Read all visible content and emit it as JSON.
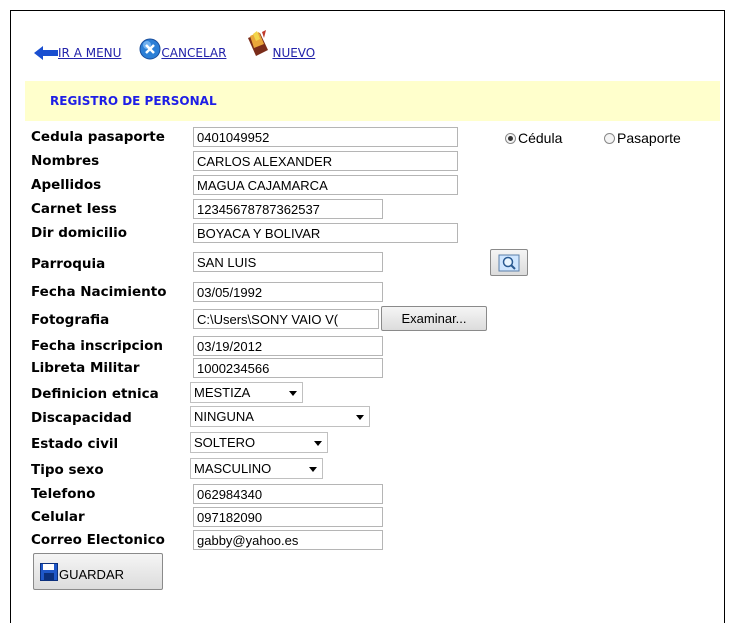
{
  "toolbar": {
    "menu_label": "IR A MENU",
    "cancel_label": "CANCELAR",
    "new_label": "NUEVO"
  },
  "header": {
    "title": "REGISTRO DE PERSONAL"
  },
  "form": {
    "cedula_label": "Cedula pasaporte",
    "cedula_value": "0401049952",
    "doc_type_options": [
      "Cédula",
      "Pasaporte"
    ],
    "doc_type_selected": "Cédula",
    "nombres_label": "Nombres",
    "nombres_value": "CARLOS ALEXANDER",
    "apellidos_label": "Apellidos",
    "apellidos_value": "MAGUA CAJAMARCA",
    "carnet_label": "Carnet Iess",
    "carnet_value": "12345678787362537",
    "dir_label": "Dir domicilio",
    "dir_value": "BOYACA Y BOLIVAR",
    "parroquia_label": "Parroquia",
    "parroquia_value": "SAN LUIS",
    "fecha_nac_label": "Fecha Nacimiento",
    "fecha_nac_value": "03/05/1992",
    "foto_label": "Fotografia",
    "foto_value": "C:\\Users\\SONY VAIO V(",
    "browse_label": "Examinar...",
    "fecha_ins_label": "Fecha inscripcion",
    "fecha_ins_value": "03/19/2012",
    "libreta_label": "Libreta Militar",
    "libreta_value": "1000234566",
    "etnica_label": "Definicion etnica",
    "etnica_value": "MESTIZA",
    "discap_label": "Discapacidad",
    "discap_value": "NINGUNA",
    "civil_label": "Estado civil",
    "civil_value": "SOLTERO",
    "sexo_label": "Tipo sexo",
    "sexo_value": "MASCULINO",
    "telefono_label": "Telefono",
    "telefono_value": "062984340",
    "celular_label": "Celular",
    "celular_value": "097182090",
    "correo_label": "Correo Electonico",
    "correo_value": "gabby@yahoo.es",
    "save_label": "GUARDAR"
  },
  "icons": {
    "menu": "arrow-left-icon",
    "cancel": "cancel-circle-icon",
    "new": "new-document-icon",
    "search": "magnifier-icon",
    "save": "floppy-disk-icon"
  },
  "colors": {
    "header_band": "#ffffcc",
    "header_text": "#1e1ee6",
    "link": "#2222aa"
  }
}
